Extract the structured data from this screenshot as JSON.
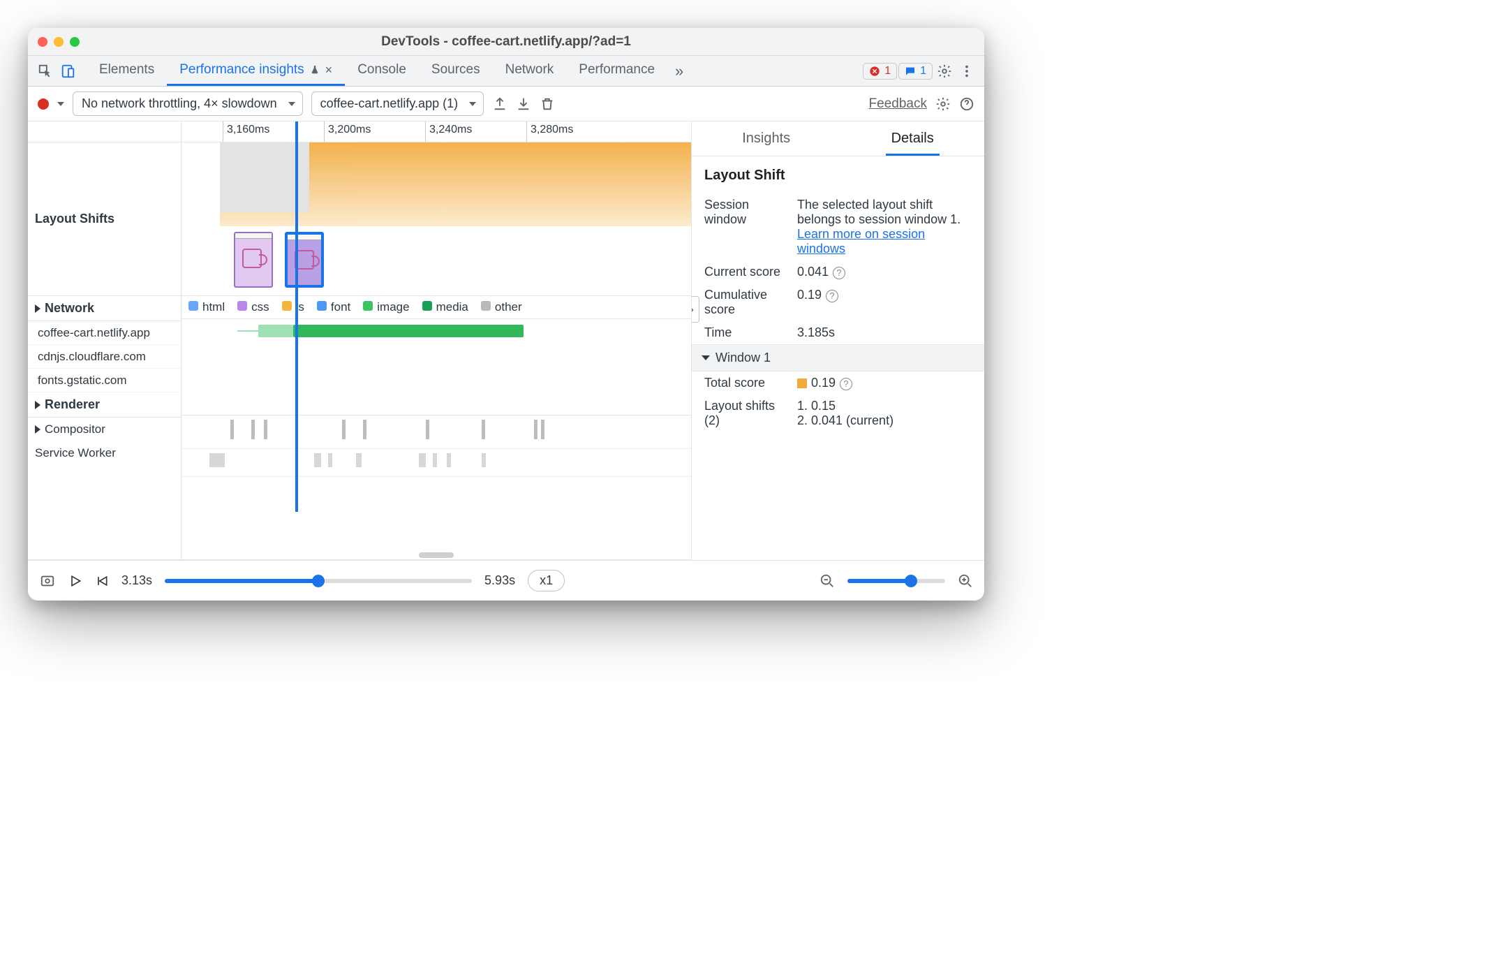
{
  "window": {
    "title": "DevTools - coffee-cart.netlify.app/?ad=1"
  },
  "tabs": {
    "items": [
      "Elements",
      "Performance insights",
      "Console",
      "Sources",
      "Network",
      "Performance"
    ],
    "active_index": 1
  },
  "badges": {
    "errors": "1",
    "messages": "1"
  },
  "toolbar": {
    "throttling": "No network throttling, 4× slowdown",
    "recording": "coffee-cart.netlify.app (1)",
    "feedback": "Feedback"
  },
  "ruler": [
    "3,160ms",
    "3,200ms",
    "3,240ms",
    "3,280ms"
  ],
  "left": {
    "layout_shifts_label": "Layout Shifts",
    "network_label": "Network",
    "network_hosts": [
      "coffee-cart.netlify.app",
      "cdnjs.cloudflare.com",
      "fonts.gstatic.com"
    ],
    "renderer_label": "Renderer",
    "compositor_label": "Compositor",
    "service_worker_label": "Service Worker",
    "legend": {
      "html": "html",
      "css": "css",
      "js": "js",
      "font": "font",
      "image": "image",
      "media": "media",
      "other": "other"
    }
  },
  "right": {
    "tabs": {
      "insights": "Insights",
      "details": "Details"
    },
    "title": "Layout Shift",
    "session_window_label": "Session window",
    "session_window_text_a": "The selected layout shift belongs to session window 1. ",
    "session_window_link": "Learn more on session windows",
    "current_score_label": "Current score",
    "current_score": "0.041",
    "cumulative_label": "Cumulative score",
    "cumulative": "0.19",
    "time_label": "Time",
    "time": "3.185s",
    "window_hdr": "Window 1",
    "total_score_label": "Total score",
    "total_score": "0.19",
    "shifts_label": "Layout shifts (2)",
    "shift1": "1. 0.15",
    "shift2": "2. 0.041 (current)"
  },
  "bottom": {
    "start": "3.13s",
    "end": "5.93s",
    "speed": "x1"
  }
}
